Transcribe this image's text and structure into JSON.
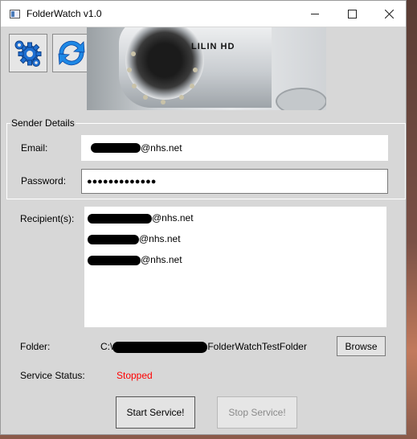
{
  "window": {
    "title": "FolderWatch v1.0",
    "minimize": "—",
    "maximize": "☐",
    "close": "✕"
  },
  "banner": {
    "brand": "LILIN HD"
  },
  "toolbar": {
    "settings_icon": "gears-icon",
    "refresh_icon": "refresh-icon"
  },
  "sender": {
    "legend": "Sender Details",
    "email_label": "Email:",
    "email_domain": "@nhs.net",
    "password_label": "Password:",
    "password_value": "●●●●●●●●●●●●●"
  },
  "recipients": {
    "label": "Recipient(s):",
    "items": [
      {
        "domain": "@nhs.net"
      },
      {
        "domain": "@nhs.net"
      },
      {
        "domain": "@nhs.net"
      }
    ]
  },
  "folder": {
    "label": "Folder:",
    "path_prefix": "C:\\",
    "path_suffix": "FolderWatchTestFolder",
    "browse_label": "Browse"
  },
  "service": {
    "label": "Service Status:",
    "status": "Stopped",
    "status_color": "#ff0000",
    "start_label": "Start Service!",
    "stop_label": "Stop Service!"
  }
}
